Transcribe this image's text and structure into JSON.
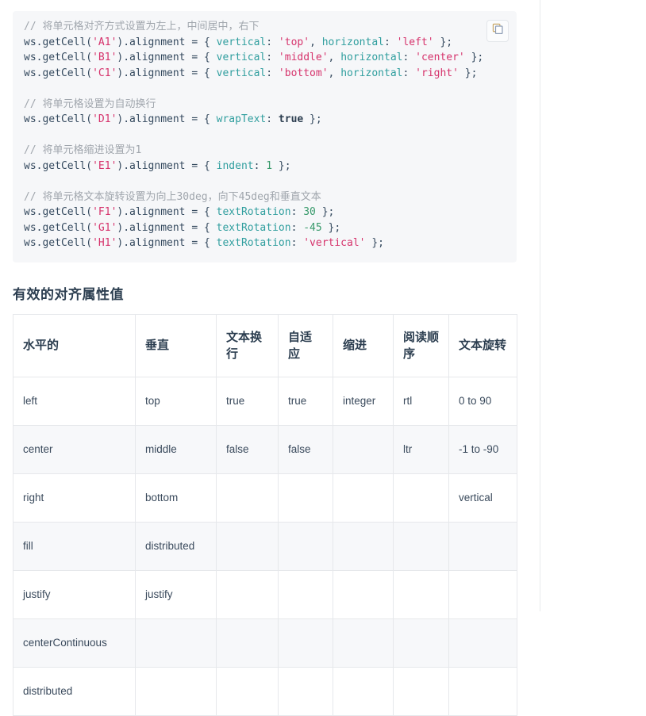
{
  "code_block": {
    "copy_button_label": "copy-code",
    "lines": [
      [
        {
          "t": "// 将单元格对齐方式设置为左上，中间居中，右下",
          "c": "cm"
        }
      ],
      [
        {
          "t": "ws.getCell(",
          "c": "pl"
        },
        {
          "t": "'A1'",
          "c": "str"
        },
        {
          "t": ").alignment = { ",
          "c": "pl"
        },
        {
          "t": "vertical",
          "c": "prop"
        },
        {
          "t": ": ",
          "c": "pl"
        },
        {
          "t": "'top'",
          "c": "str"
        },
        {
          "t": ", ",
          "c": "pl"
        },
        {
          "t": "horizontal",
          "c": "prop"
        },
        {
          "t": ": ",
          "c": "pl"
        },
        {
          "t": "'left'",
          "c": "str"
        },
        {
          "t": " };",
          "c": "pl"
        }
      ],
      [
        {
          "t": "ws.getCell(",
          "c": "pl"
        },
        {
          "t": "'B1'",
          "c": "str"
        },
        {
          "t": ").alignment = { ",
          "c": "pl"
        },
        {
          "t": "vertical",
          "c": "prop"
        },
        {
          "t": ": ",
          "c": "pl"
        },
        {
          "t": "'middle'",
          "c": "str"
        },
        {
          "t": ", ",
          "c": "pl"
        },
        {
          "t": "horizontal",
          "c": "prop"
        },
        {
          "t": ": ",
          "c": "pl"
        },
        {
          "t": "'center'",
          "c": "str"
        },
        {
          "t": " };",
          "c": "pl"
        }
      ],
      [
        {
          "t": "ws.getCell(",
          "c": "pl"
        },
        {
          "t": "'C1'",
          "c": "str"
        },
        {
          "t": ").alignment = { ",
          "c": "pl"
        },
        {
          "t": "vertical",
          "c": "prop"
        },
        {
          "t": ": ",
          "c": "pl"
        },
        {
          "t": "'bottom'",
          "c": "str"
        },
        {
          "t": ", ",
          "c": "pl"
        },
        {
          "t": "horizontal",
          "c": "prop"
        },
        {
          "t": ": ",
          "c": "pl"
        },
        {
          "t": "'right'",
          "c": "str"
        },
        {
          "t": " };",
          "c": "pl"
        }
      ],
      [],
      [
        {
          "t": "// 将单元格设置为自动换行",
          "c": "cm"
        }
      ],
      [
        {
          "t": "ws.getCell(",
          "c": "pl"
        },
        {
          "t": "'D1'",
          "c": "str"
        },
        {
          "t": ").alignment = { ",
          "c": "pl"
        },
        {
          "t": "wrapText",
          "c": "prop"
        },
        {
          "t": ": ",
          "c": "pl"
        },
        {
          "t": "true",
          "c": "kw"
        },
        {
          "t": " };",
          "c": "pl"
        }
      ],
      [],
      [
        {
          "t": "// 将单元格缩进设置为1",
          "c": "cm"
        }
      ],
      [
        {
          "t": "ws.getCell(",
          "c": "pl"
        },
        {
          "t": "'E1'",
          "c": "str"
        },
        {
          "t": ").alignment = { ",
          "c": "pl"
        },
        {
          "t": "indent",
          "c": "prop"
        },
        {
          "t": ": ",
          "c": "pl"
        },
        {
          "t": "1",
          "c": "num"
        },
        {
          "t": " };",
          "c": "pl"
        }
      ],
      [],
      [
        {
          "t": "// 将单元格文本旋转设置为向上30deg，向下45deg和垂直文本",
          "c": "cm"
        }
      ],
      [
        {
          "t": "ws.getCell(",
          "c": "pl"
        },
        {
          "t": "'F1'",
          "c": "str"
        },
        {
          "t": ").alignment = { ",
          "c": "pl"
        },
        {
          "t": "textRotation",
          "c": "prop"
        },
        {
          "t": ": ",
          "c": "pl"
        },
        {
          "t": "30",
          "c": "num"
        },
        {
          "t": " };",
          "c": "pl"
        }
      ],
      [
        {
          "t": "ws.getCell(",
          "c": "pl"
        },
        {
          "t": "'G1'",
          "c": "str"
        },
        {
          "t": ").alignment = { ",
          "c": "pl"
        },
        {
          "t": "textRotation",
          "c": "prop"
        },
        {
          "t": ": ",
          "c": "pl"
        },
        {
          "t": "-45",
          "c": "num"
        },
        {
          "t": " };",
          "c": "pl"
        }
      ],
      [
        {
          "t": "ws.getCell(",
          "c": "pl"
        },
        {
          "t": "'H1'",
          "c": "str"
        },
        {
          "t": ").alignment = { ",
          "c": "pl"
        },
        {
          "t": "textRotation",
          "c": "prop"
        },
        {
          "t": ": ",
          "c": "pl"
        },
        {
          "t": "'vertical'",
          "c": "str"
        },
        {
          "t": " };",
          "c": "pl"
        }
      ]
    ]
  },
  "section": {
    "title": "有效的对齐属性值"
  },
  "table": {
    "headers": [
      "水平的",
      "垂直",
      "文本换行",
      "自适应",
      "缩进",
      "阅读顺序",
      "文本旋转"
    ],
    "rows": [
      [
        "left",
        "top",
        "true",
        "true",
        "integer",
        "rtl",
        "0 to 90"
      ],
      [
        "center",
        "middle",
        "false",
        "false",
        "",
        "ltr",
        "-1 to -90"
      ],
      [
        "right",
        "bottom",
        "",
        "",
        "",
        "",
        "vertical"
      ],
      [
        "fill",
        "distributed",
        "",
        "",
        "",
        "",
        ""
      ],
      [
        "justify",
        "justify",
        "",
        "",
        "",
        "",
        ""
      ],
      [
        "centerContinuous",
        "",
        "",
        "",
        "",
        "",
        ""
      ],
      [
        "distributed",
        "",
        "",
        "",
        "",
        "",
        ""
      ]
    ]
  },
  "colors": {
    "code_bg": "#f6f7f9",
    "comment": "#a0a6ad",
    "string": "#d6336c",
    "property": "#2f9e9e",
    "number": "#389a6b",
    "plain": "#34495e",
    "table_border": "#e6e8eb",
    "table_stripe": "#f7f8fa",
    "heading": "#2c3e50"
  }
}
